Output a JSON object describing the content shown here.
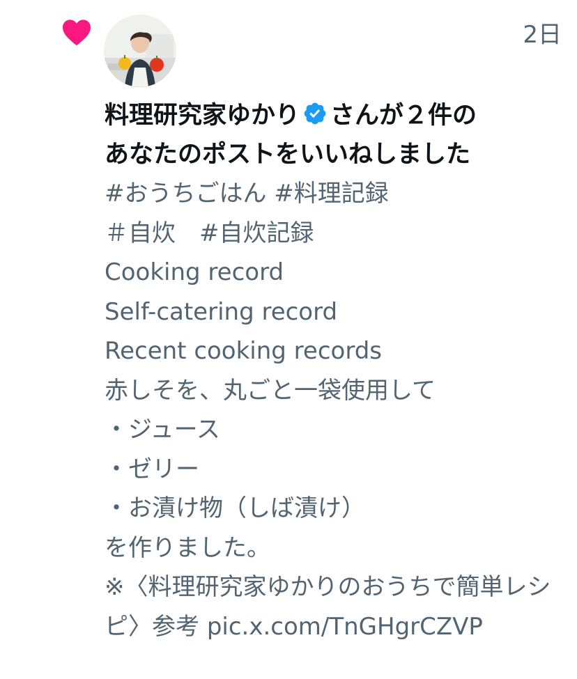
{
  "notification": {
    "type_icon": "heart-icon",
    "avatar_icon": "avatar-photo",
    "timestamp": "2日",
    "user_name": "料理研究家ゆかり",
    "verified_icon": "verified-badge-icon",
    "action_text_1": "さんが２件の",
    "action_text_2": "あなたのポストをいいねしました"
  },
  "post": {
    "lines": [
      "#おうちごはん #料理記録",
      "＃自炊　#自炊記録",
      "Cooking record",
      "Self-catering record",
      "Recent cooking records",
      "赤しそを、丸ごと一袋使用して",
      "・ジュース",
      "・ゼリー",
      "・お漬け物（しば漬け）",
      "を作りました。",
      "※〈料理研究家ゆかりのおうちで簡単レシピ〉参考 "
    ],
    "link": "pic.x.com/TnGHgrCZVP"
  },
  "colors": {
    "heart": "#f91880",
    "verified": "#1d9bf0",
    "primary_text": "#0f1419",
    "secondary_text": "#536471",
    "background": "#ffffff"
  }
}
